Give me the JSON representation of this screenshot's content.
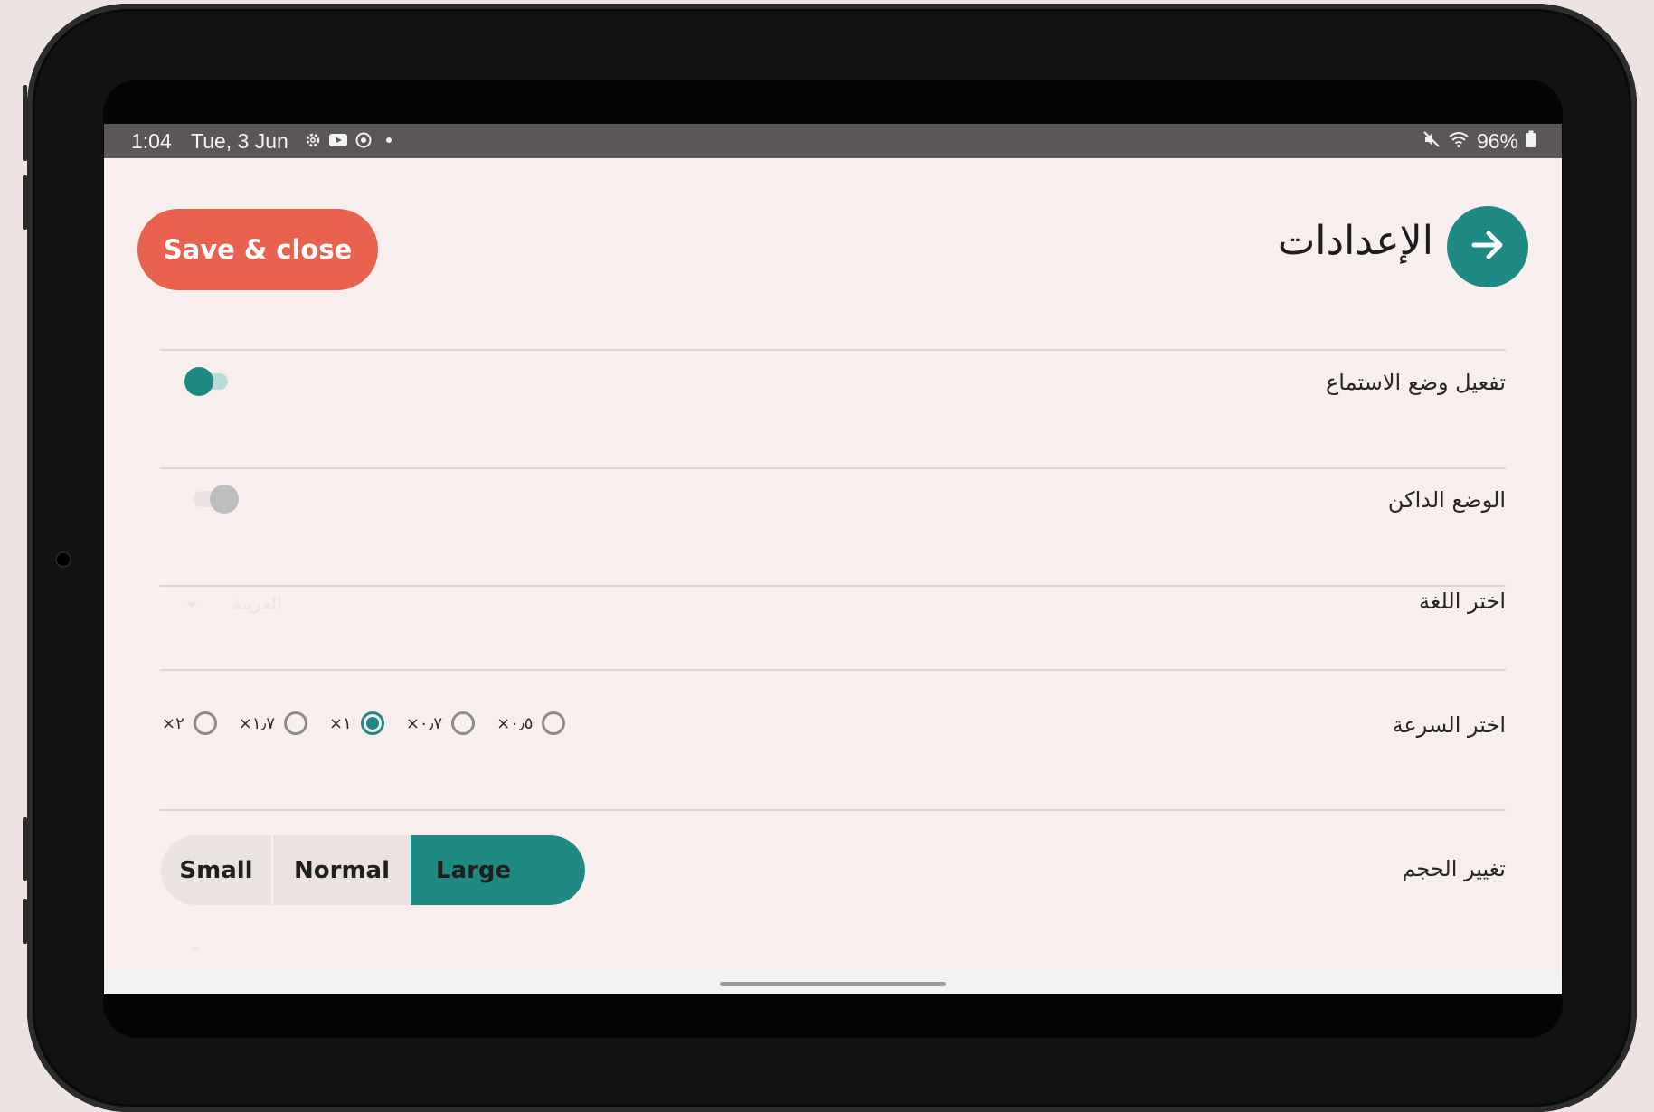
{
  "status_bar": {
    "time": "1:04",
    "date": "Tue, 3 Jun",
    "battery": "96%",
    "left_icons": [
      "settings-icon",
      "youtube-icon",
      "sync-icon"
    ],
    "right_icons": [
      "mute-icon",
      "wifi-icon",
      "battery-icon"
    ]
  },
  "header": {
    "save_label": "Save & close",
    "title": "الإعدادات"
  },
  "settings": {
    "listening_mode_label": "تفعيل وضع الاستماع",
    "listening_mode_on": true,
    "dark_mode_label": "الوضع الداكن",
    "dark_mode_on": false,
    "language_label": "اختر اللغة",
    "language_value": "العربية",
    "speed_label": "اختر السرعة",
    "speed_options": [
      "×٢",
      "×١٫٧",
      "×١",
      "×٠٫٧",
      "×٠٫٥"
    ],
    "speed_selected": "×١",
    "size_label": "تغيير الحجم",
    "size_options": [
      "Small",
      "Normal",
      "Large"
    ],
    "size_selected": "Large"
  },
  "colors": {
    "accent": "#1f8a83",
    "save_button": "#e8624f",
    "background": "#f7eeed",
    "status_bar": "#5b5757"
  }
}
